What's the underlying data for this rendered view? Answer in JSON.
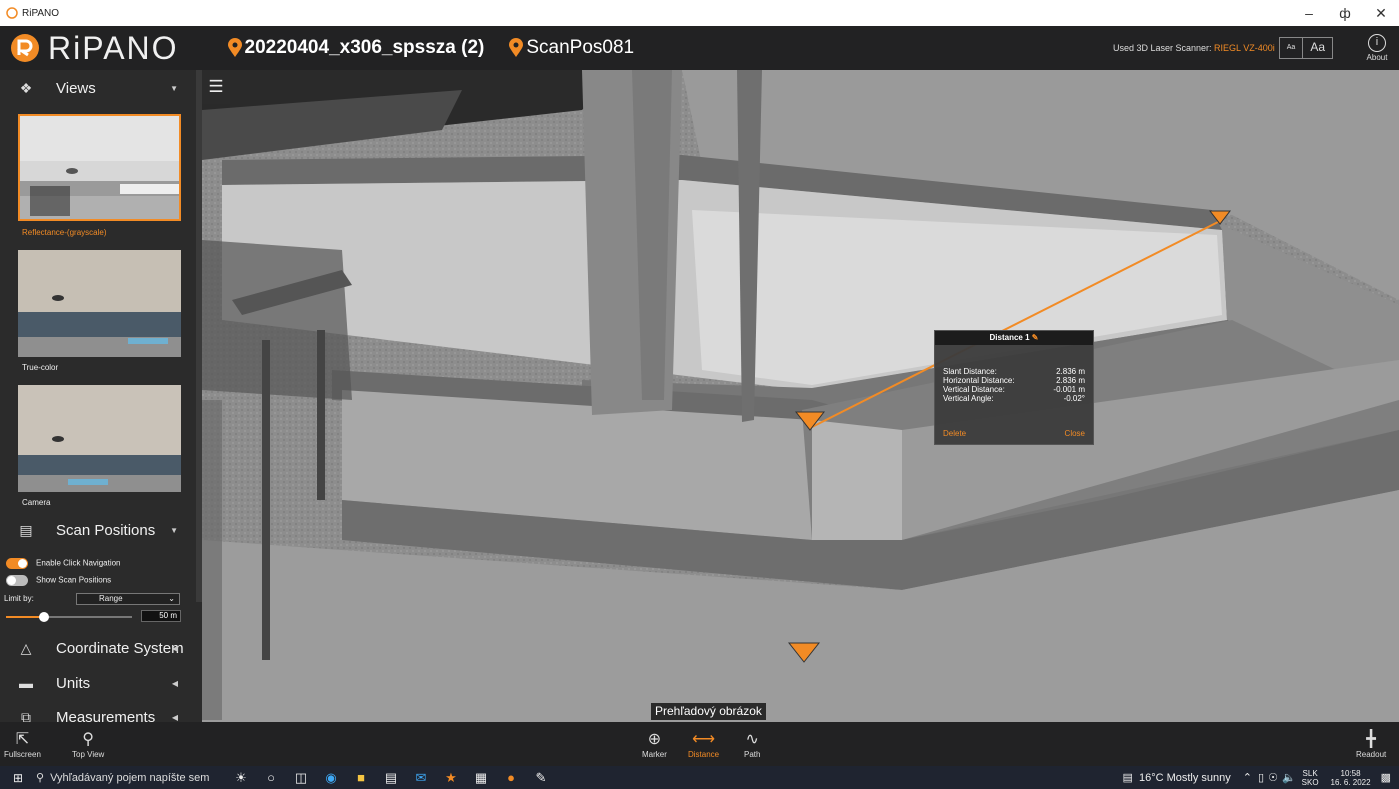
{
  "window": {
    "title": "RiPANO",
    "min": "–",
    "max": "ф",
    "close": "✕"
  },
  "header": {
    "logo": "RiPANO",
    "project": "20220404_x306_spssza (2)",
    "scan_position": "ScanPos081",
    "scanner_label": "Used 3D Laser Scanner:",
    "scanner_model": "RIEGL VZ-400i",
    "font_small": "Aa",
    "font_large": "Aa",
    "about": "About"
  },
  "sidebar": {
    "views": {
      "title": "Views",
      "items": [
        {
          "label": "Reflectance-(grayscale)",
          "selected": true
        },
        {
          "label": "True-color",
          "selected": false
        },
        {
          "label": "Camera",
          "selected": false
        }
      ]
    },
    "scan_positions": {
      "title": "Scan Positions",
      "enable_click_navigation": "Enable Click Navigation",
      "show_scan_positions": "Show Scan Positions",
      "limit_by_label": "Limit by:",
      "limit_by_value": "Range",
      "range_value": "50 m",
      "range_fraction": 0.3
    },
    "coordinate_system": {
      "title": "Coordinate System"
    },
    "units": {
      "title": "Units"
    },
    "measurements": {
      "title": "Measurements"
    }
  },
  "measurement": {
    "title": "Distance 1",
    "rows": [
      {
        "label": "Slant Distance:",
        "value": "2.836 m"
      },
      {
        "label": "Horizontal Distance:",
        "value": "2.836 m"
      },
      {
        "label": "Vertical Distance:",
        "value": "-0.001 m"
      },
      {
        "label": "Vertical Angle:",
        "value": "-0.02°"
      }
    ],
    "delete": "Delete",
    "close": "Close"
  },
  "overlay_label": "Prehľadový obrázok",
  "toolbar": {
    "fullscreen": "Fullscreen",
    "top_view": "Top View",
    "marker": "Marker",
    "distance": "Distance",
    "path": "Path",
    "readout": "Readout"
  },
  "taskbar": {
    "search_placeholder": "Vyhľadávaný pojem napíšte sem",
    "weather": "16°C  Mostly sunny",
    "lang_top": "SLK",
    "lang_bottom": "SKO",
    "time": "10:58",
    "date": "16. 6. 2022"
  },
  "colors": {
    "accent": "#f28b25",
    "header_bg": "#222223",
    "sidebar_bg": "#2b2b2b"
  }
}
